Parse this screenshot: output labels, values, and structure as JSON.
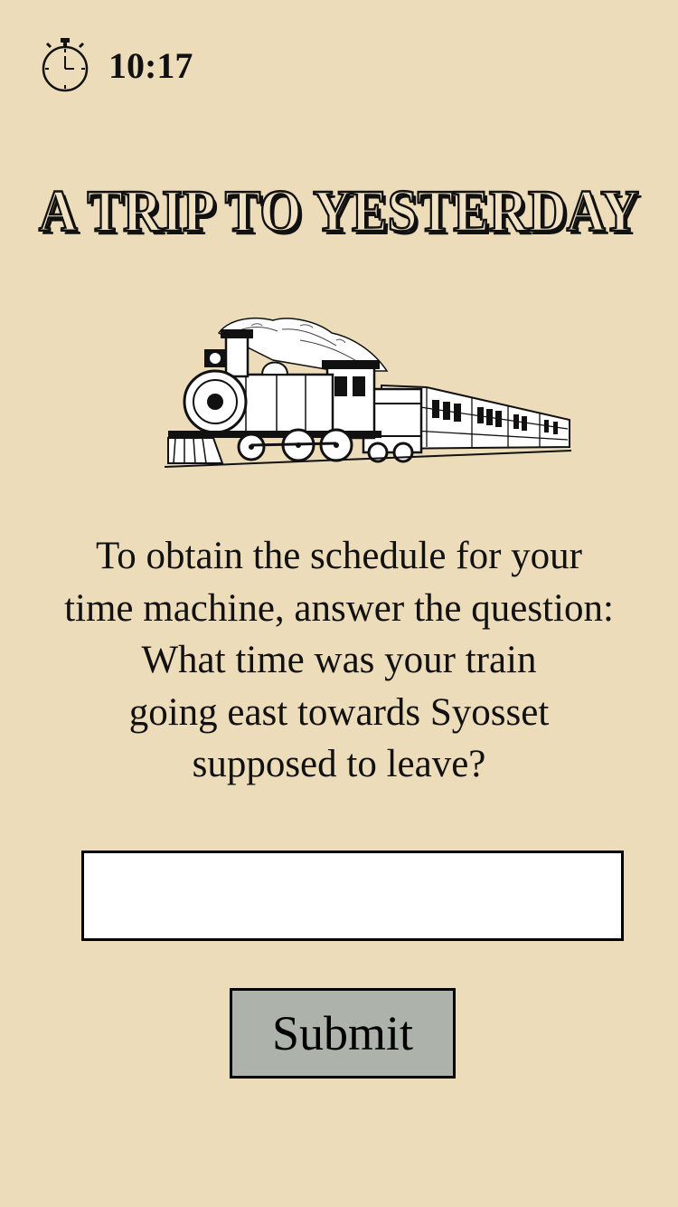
{
  "colors": {
    "background": "#eddcba",
    "button_bg": "#adb2ab",
    "input_bg": "#ffffff",
    "text": "#111111"
  },
  "timer": {
    "icon": "stopwatch-icon",
    "value": "10:17"
  },
  "title": "A TRIP TO YESTERDAY",
  "illustration": {
    "icon": "steam-locomotive-icon"
  },
  "prompt": {
    "lines": [
      "To obtain the schedule for your",
      "time machine, answer the question:",
      "What time was your train",
      "going east towards Syosset",
      "supposed to leave?"
    ]
  },
  "answer_field": {
    "value": "",
    "placeholder": ""
  },
  "submit_label": "Submit"
}
